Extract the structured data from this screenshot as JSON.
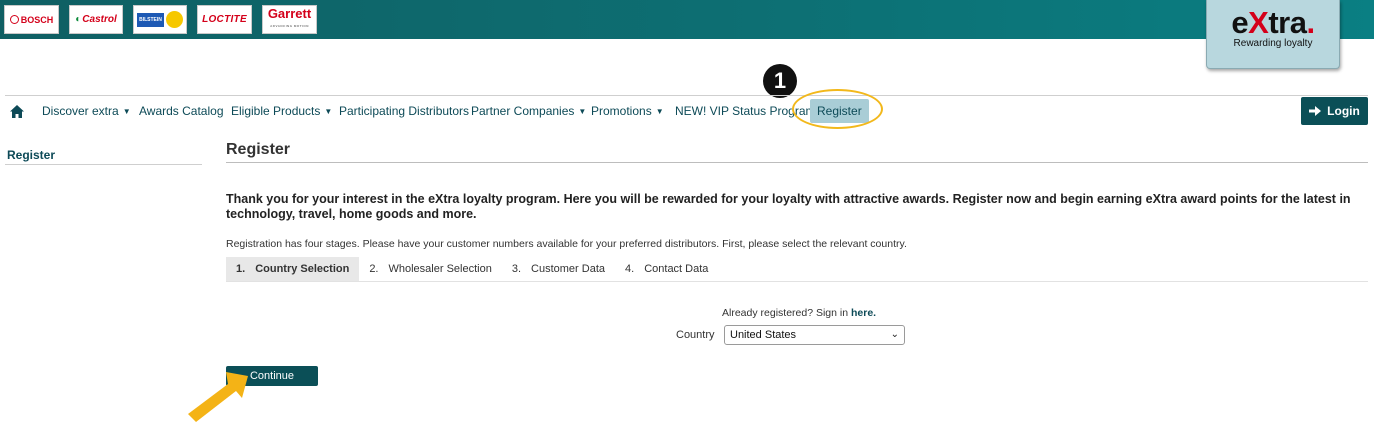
{
  "brands": {
    "bosch": "BOSCH",
    "castrol": "Castrol",
    "bilstein": "BILSTEIN",
    "loctite": "LOCTITE",
    "garrett": "Garrett",
    "garrett_sub": "ADVANCING MOTION"
  },
  "badge": {
    "word_e": "e",
    "word_x": "X",
    "word_tra": "tra",
    "word_dot": ".",
    "tagline": "Rewarding loyalty"
  },
  "callout": "1",
  "nav": {
    "home_icon": "home-icon",
    "items": [
      {
        "label": "Discover extra"
      },
      {
        "label": "Awards Catalog"
      },
      {
        "label": "Eligible Products"
      },
      {
        "label": "Participating Distributors"
      },
      {
        "label": "Partner Companies"
      },
      {
        "label": "Promotions"
      },
      {
        "label": "NEW! VIP Status Program"
      },
      {
        "label": "Register"
      }
    ],
    "caret": "▼",
    "login_label": "Login"
  },
  "sidebar": {
    "title": "Register"
  },
  "main": {
    "title": "Register",
    "intro": "Thank you for your interest in the eXtra loyalty program. Here you will be rewarded for your loyalty with attractive awards. Register now and begin earning eXtra award points for the latest in technology, travel, home goods and more.",
    "stages_note": "Registration has four stages. Please have your customer numbers available for your preferred distributors. First, please select the relevant country.",
    "steps": [
      {
        "num": "1.",
        "label": "Country Selection"
      },
      {
        "num": "2.",
        "label": "Wholesaler Selection"
      },
      {
        "num": "3.",
        "label": "Customer Data"
      },
      {
        "num": "4.",
        "label": "Contact Data"
      }
    ],
    "signin_prefix": "Already registered? Sign in",
    "signin_link": "here.",
    "country_label": "Country",
    "country_value": "United States",
    "continue_label": "Continue"
  },
  "colors": {
    "header_teal": "#0d6f73",
    "nav_text": "#0d4a57",
    "button_bg": "#0b4f57",
    "active_tab_bg": "#a9cdd6",
    "highlight": "#f2b81b",
    "brand_red": "#d4001a"
  }
}
